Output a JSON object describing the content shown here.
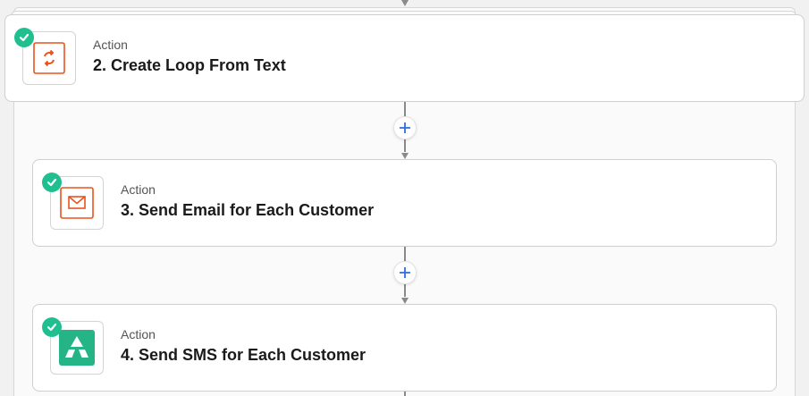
{
  "steps": [
    {
      "kind": "Action",
      "title": "2. Create Loop From Text",
      "icon": "loop-icon",
      "status": "complete"
    },
    {
      "kind": "Action",
      "title": "3. Send Email for Each Customer",
      "icon": "email-icon",
      "status": "complete"
    },
    {
      "kind": "Action",
      "title": "4. Send SMS for Each Customer",
      "icon": "sms-app-icon",
      "status": "complete"
    }
  ],
  "colors": {
    "check_green": "#1fbf8f",
    "loop_orange": "#e8531f",
    "sms_green": "#25b486",
    "plus_blue": "#2f6fde"
  }
}
